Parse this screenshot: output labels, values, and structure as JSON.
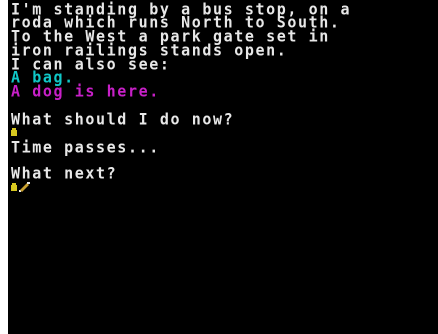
{
  "description": [
    "I'm standing by a bus stop, on a",
    "roda which runs North to South.",
    "To the West a park gate set in",
    "iron railings stands open.",
    "I can also see:"
  ],
  "items": [
    {
      "text": "A bag.",
      "color": "#10c8c8"
    },
    {
      "text": "A dog is here.",
      "color": "#c820c8"
    }
  ],
  "transcript": [
    {
      "text": "What should I do now?",
      "marker": "cursor-icon"
    },
    {
      "text": "Time passes...",
      "marker": null
    },
    {
      "text": "What next?",
      "marker": "cursor-with-pencil-icon"
    }
  ],
  "colors": {
    "background": "#000000",
    "text": "#e8e8e8",
    "cursor": "#d8c820",
    "pencil": "#c8a030"
  }
}
